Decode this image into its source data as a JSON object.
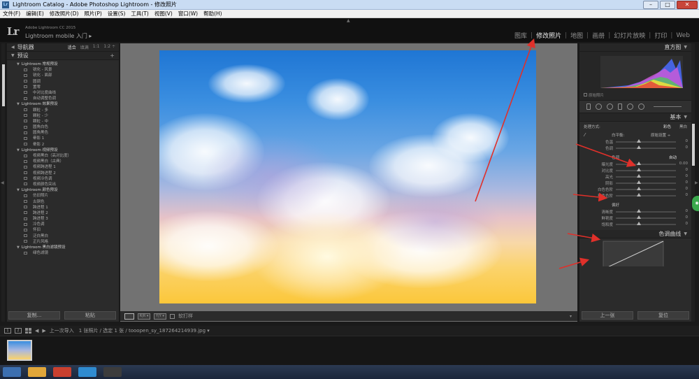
{
  "window": {
    "app_icon": "Lr",
    "title": "Lightroom Catalog - Adobe Photoshop Lightroom - 修改照片",
    "minimize": "–",
    "maximize": "□",
    "close": "✕"
  },
  "menu": [
    "文件(F)",
    "编辑(E)",
    "修改照片(D)",
    "照片(P)",
    "设置(S)",
    "工具(T)",
    "视图(V)",
    "窗口(W)",
    "帮助(H)"
  ],
  "identity": {
    "logo": "Lr",
    "product": "Adobe Lightroom CC 2015",
    "mobile": "Lightroom mobile 入门 ▸"
  },
  "modules": [
    "图库",
    "修改照片",
    "地图",
    "画册",
    "幻灯片放映",
    "打印",
    "Web"
  ],
  "active_module": "修改照片",
  "left_panel": {
    "navigator_title": "导航器",
    "navigator_zoom": [
      "适合",
      "填满",
      "1:1",
      "1:2 ÷"
    ],
    "presets_title": "预设",
    "add_preset": "+",
    "folders": [
      {
        "name": "Lightroom 常规预设",
        "items": [
          "锐化 - 风景",
          "锐化 - 面部",
          "圆调",
          "置零",
          "中对比度曲线",
          "自动调整色调"
        ]
      },
      {
        "name": "Lightroom 效果预设",
        "items": [
          "颗粒 - 多",
          "颗粒 - 少",
          "颗粒 - 中",
          "圆角白色",
          "圆角黑色",
          "晕影 1",
          "晕影 2"
        ]
      },
      {
        "name": "Lightroom 视频预设",
        "items": [
          "视频黑白（高对比度）",
          "视频黑白（古典）",
          "视频跨进程 1",
          "视频跨进程 2",
          "视频冷色调",
          "视频颜色突出"
        ]
      },
      {
        "name": "Lightroom 颜色预设",
        "items": [
          "仿旧照片",
          "古铜色",
          "跨进程 1",
          "跨进程 2",
          "跨进程 3",
          "冷色调",
          "怀旧",
          "泛白黑白",
          "正片风格"
        ]
      },
      {
        "name": "Lightroom 黑白滤镜预设",
        "items": [
          "绿色滤镜"
        ]
      }
    ],
    "copy_button": "复制...",
    "paste_button": "粘贴"
  },
  "center_toolbar": {
    "soft_proof_label": "软打样",
    "view_compare": "Y|Y ▾",
    "view_before_after": "R|R ▾",
    "caret": "▾"
  },
  "right_panel": {
    "histogram_title": "直方图",
    "original_photo_label": "原始照片",
    "basic_title": "基本",
    "treatment_label": "处理方式:",
    "treatment_color": "彩色",
    "treatment_bw": "黑白",
    "wb_label": "白平衡:",
    "wb_value": "原始设置 ÷",
    "wb_sliders": [
      {
        "label": "色温",
        "value": "0"
      },
      {
        "label": "色调",
        "value": "0"
      }
    ],
    "tone_label": "色调",
    "tone_auto": "自动",
    "tone_sliders": [
      {
        "label": "曝光度",
        "value": "0.00"
      },
      {
        "label": "对比度",
        "value": "0"
      },
      {
        "label": "高光",
        "value": "0"
      },
      {
        "label": "阴影",
        "value": "0"
      },
      {
        "label": "白色色阶",
        "value": "0"
      },
      {
        "label": "黑色色阶",
        "value": "0"
      }
    ],
    "presence_label": "偏好",
    "presence_sliders": [
      {
        "label": "清晰度",
        "value": "0"
      },
      {
        "label": "鲜艳度",
        "value": "0"
      },
      {
        "label": "饱和度",
        "value": "0"
      }
    ],
    "tone_curve_title": "色调曲线",
    "prev_button": "上一张",
    "reset_button": "复位"
  },
  "filmstrip": {
    "page_1": "1",
    "page_2": "2",
    "info": "上一次导入　1 张照片 / 选定 1 张 / tooopen_sy_187264214939.jpg ▾"
  },
  "colors": {
    "annotation": "#e0302a",
    "panel_bg": "#2b2b2b",
    "center_bg": "#727272"
  }
}
